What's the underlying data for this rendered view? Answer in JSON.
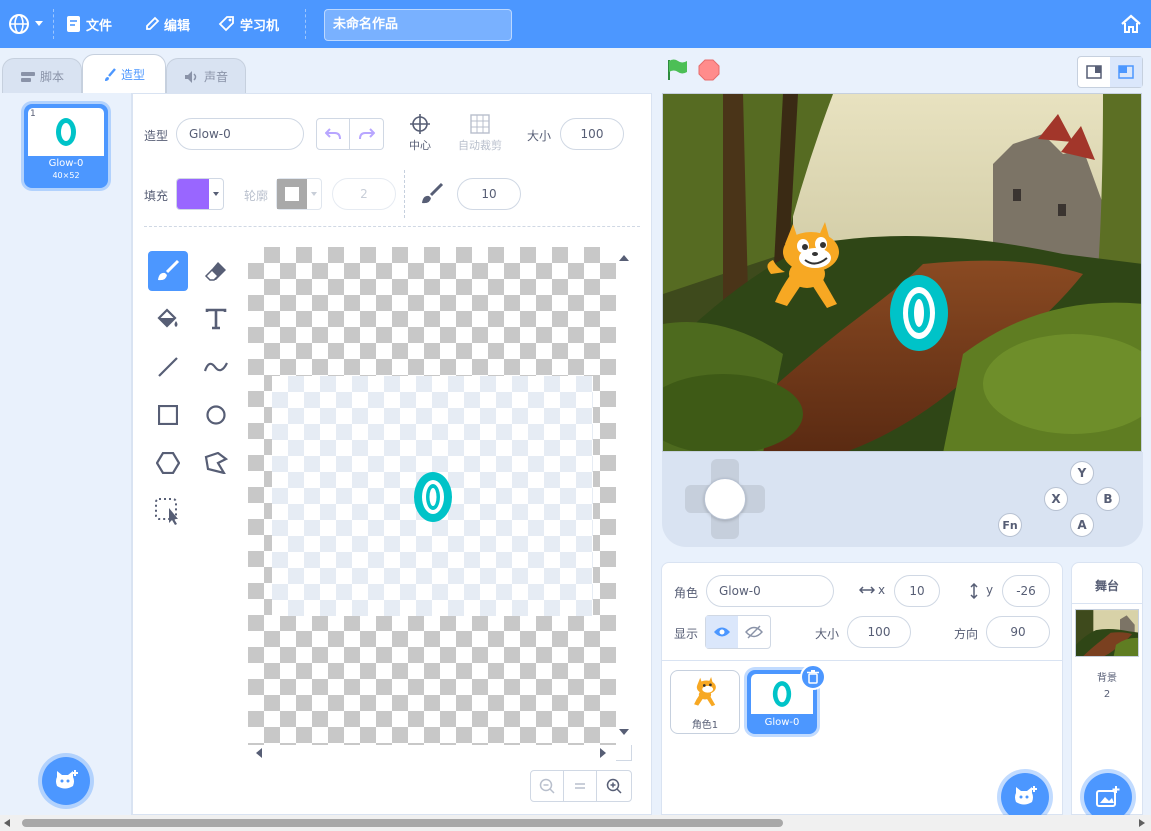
{
  "menubar": {
    "file_label": "文件",
    "edit_label": "编辑",
    "learn_label": "学习机",
    "project_title": "未命名作品"
  },
  "tabs": [
    {
      "label": "脚本"
    },
    {
      "label": "造型"
    },
    {
      "label": "声音"
    }
  ],
  "costume_list": [
    {
      "index": "1",
      "name": "Glow-0",
      "size": "40×52"
    }
  ],
  "editor": {
    "costume_label": "造型",
    "costume_name": "Glow-0",
    "center_label": "中心",
    "autocrop_label": "自动裁剪",
    "size_label": "大小",
    "size_value": "100",
    "fill_label": "填充",
    "fill_color": "#9966ff",
    "outline_label": "轮廓",
    "outline_width": "2",
    "brush_size": "10",
    "canvas_glyph": "0"
  },
  "tools": [
    "brush-tool",
    "eraser-tool",
    "fill-tool",
    "text-tool",
    "line-tool",
    "curve-tool",
    "rect-tool",
    "circle-tool",
    "polygon-tool",
    "reshape-tool",
    "select-tool"
  ],
  "gamepad": {
    "y": "Y",
    "x": "X",
    "b": "B",
    "a": "A",
    "fn": "Fn"
  },
  "sprite_info": {
    "sprite_label": "角色",
    "sprite_name": "Glow-0",
    "x_label": "x",
    "x_value": "10",
    "y_label": "y",
    "y_value": "-26",
    "show_label": "显示",
    "size_label": "大小",
    "size_value": "100",
    "direction_label": "方向",
    "direction_value": "90"
  },
  "sprites": [
    {
      "name": "角色1"
    },
    {
      "name": "Glow-0"
    }
  ],
  "stage_panel": {
    "title": "舞台",
    "backdrop_label": "背景",
    "backdrop_count": "2"
  },
  "colors": {
    "accent": "#4c97ff",
    "sprite_glyph": "#00c3c8"
  }
}
